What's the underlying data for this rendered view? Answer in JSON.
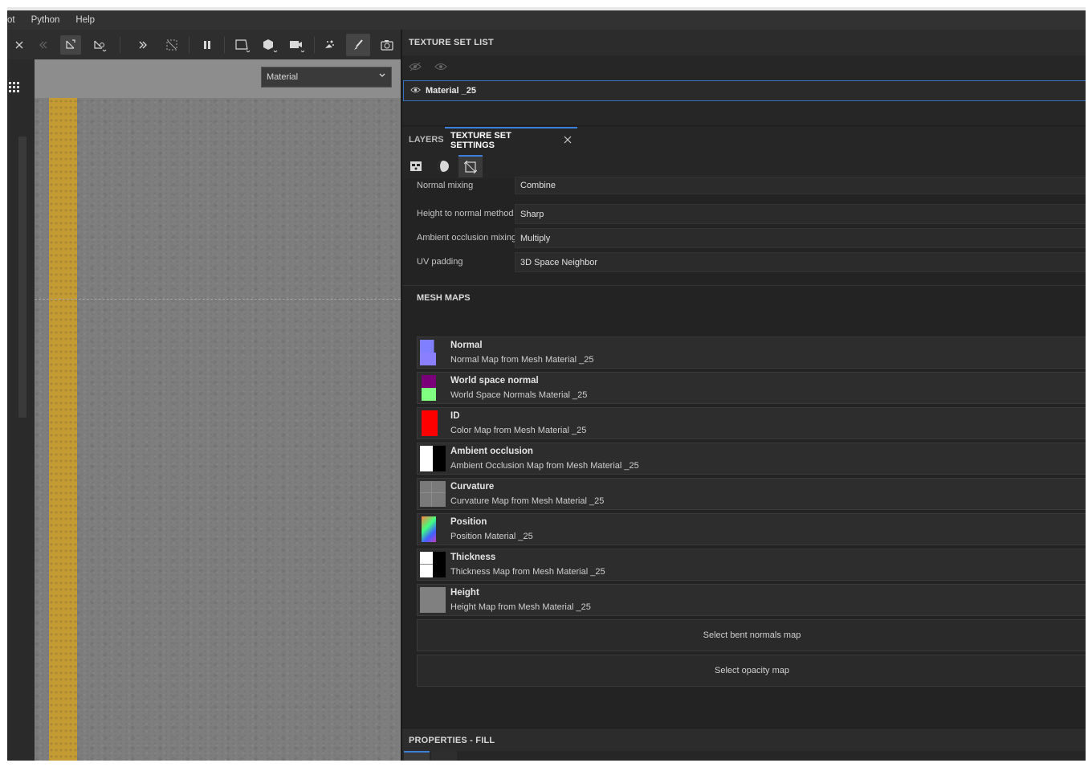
{
  "menu": {
    "items": [
      "ot",
      "Python",
      "Help"
    ]
  },
  "viewport": {
    "material_select": "Material"
  },
  "texture_set_list": {
    "title": "TEXTURE SET LIST",
    "selected_item": "Material _25"
  },
  "tabs": {
    "layers": "LAYERS",
    "texture_set_settings": "TEXTURE SET SETTINGS"
  },
  "settings": {
    "normal_mixing": {
      "label": "Normal mixing",
      "value": "Combine"
    },
    "height_to_normal": {
      "label": "Height to normal method",
      "value": "Sharp"
    },
    "ao_mixing": {
      "label": "Ambient occlusion mixing",
      "value": "Multiply"
    },
    "uv_padding": {
      "label": "UV padding",
      "value": "3D Space Neighbor"
    }
  },
  "mesh_maps": {
    "title": "MESH MAPS",
    "items": [
      {
        "name": "Normal",
        "source": "Normal Map from Mesh Material _25"
      },
      {
        "name": "World space normal",
        "source": "World Space Normals Material _25"
      },
      {
        "name": "ID",
        "source": "Color Map from Mesh Material _25"
      },
      {
        "name": "Ambient occlusion",
        "source": "Ambient Occlusion Map from Mesh Material _25"
      },
      {
        "name": "Curvature",
        "source": "Curvature Map from Mesh Material _25"
      },
      {
        "name": "Position",
        "source": "Position Material _25"
      },
      {
        "name": "Thickness",
        "source": "Thickness Map from Mesh Material _25"
      },
      {
        "name": "Height",
        "source": "Height Map from Mesh Material _25"
      }
    ],
    "bent_normals_button": "Select bent normals map",
    "opacity_button": "Select opacity map"
  },
  "properties": {
    "title": "PROPERTIES - FILL"
  },
  "colors": {
    "accent": "#3b7fd9",
    "panel": "#232323",
    "road_line": "#c49a32"
  }
}
